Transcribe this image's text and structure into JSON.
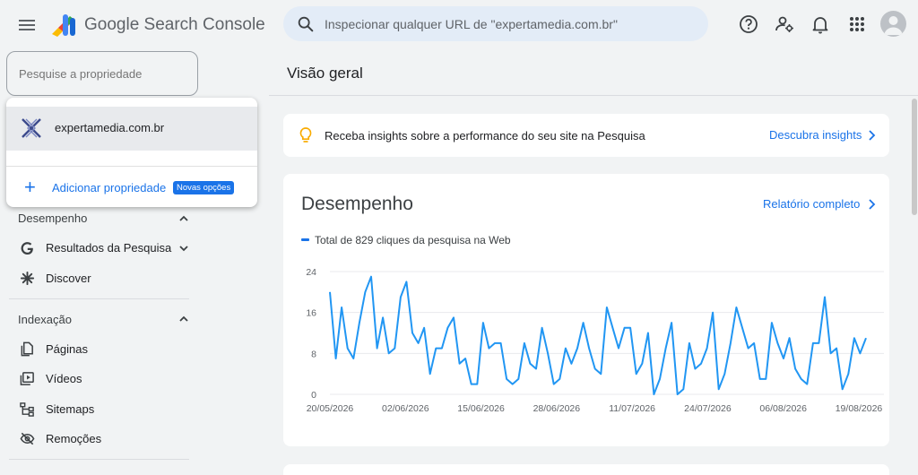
{
  "header": {
    "brand": "Google Search Console",
    "search_placeholder": "Inspecionar qualquer URL de \"expertamedia.com.br\"",
    "icons": [
      "menu-icon",
      "help-icon",
      "manage-accounts-icon",
      "notifications-icon",
      "apps-icon",
      "account-avatar"
    ]
  },
  "property_selector": {
    "placeholder": "Pesquise a propriedade",
    "selected": "expertamedia.com.br",
    "add_label": "Adicionar propriedade",
    "badge": "Novas opções"
  },
  "sidebar": {
    "sections": [
      {
        "label": "Desempenho",
        "items": [
          {
            "label": "Resultados da Pesquisa",
            "icon": "google-g-icon"
          },
          {
            "label": "Discover",
            "icon": "discover-icon"
          }
        ]
      },
      {
        "label": "Indexação",
        "items": [
          {
            "label": "Páginas",
            "icon": "pages-icon"
          },
          {
            "label": "Vídeos",
            "icon": "video-icon"
          },
          {
            "label": "Sitemaps",
            "icon": "sitemap-icon"
          },
          {
            "label": "Remoções",
            "icon": "removals-icon"
          }
        ]
      }
    ]
  },
  "main": {
    "title": "Visão geral",
    "insights": {
      "text": "Receba insights sobre a performance do seu site na Pesquisa",
      "link": "Descubra insights"
    },
    "performance": {
      "title": "Desempenho",
      "link": "Relatório completo",
      "legend": "Total de 829 cliques da pesquisa na Web"
    }
  },
  "colors": {
    "accent": "#1a73e8",
    "background": "#f1f3f4",
    "card": "#ffffff",
    "line": "#2196f3",
    "badge": "#1a73e8"
  },
  "chart_data": {
    "type": "line",
    "title": "",
    "xlabel": "",
    "ylabel": "",
    "ylim": [
      0,
      24
    ],
    "yticks": [
      "0",
      "8",
      "16",
      "24"
    ],
    "grid": true,
    "x_tick_labels": [
      "20/05/2026",
      "02/06/2026",
      "15/06/2026",
      "28/06/2026",
      "11/07/2026",
      "24/07/2026",
      "06/08/2026",
      "19/08/2026"
    ],
    "series": [
      {
        "name": "Total de 829 cliques da pesquisa na Web",
        "values": [
          20,
          7,
          17,
          9,
          7,
          14,
          20,
          23,
          9,
          15,
          8,
          9,
          19,
          22,
          12,
          10,
          13,
          4,
          9,
          9,
          13,
          15,
          6,
          7,
          2,
          2,
          14,
          9,
          10,
          10,
          3,
          2,
          3,
          10,
          6,
          5,
          13,
          8,
          2,
          3,
          9,
          6,
          9,
          14,
          9,
          5,
          4,
          17,
          13,
          9,
          13,
          13,
          4,
          6,
          12,
          0,
          3,
          9,
          14,
          0,
          1,
          10,
          5,
          6,
          9,
          16,
          1,
          4,
          10,
          17,
          13,
          9,
          10,
          3,
          3,
          14,
          10,
          7,
          11,
          5,
          3,
          2,
          10,
          10,
          19,
          8,
          9,
          1,
          4,
          11,
          8,
          11
        ]
      }
    ]
  }
}
